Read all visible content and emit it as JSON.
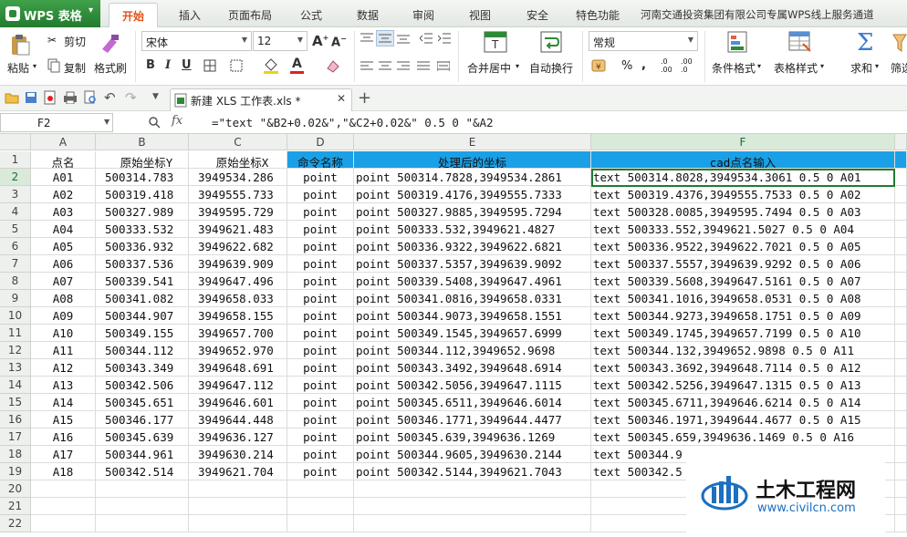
{
  "app": {
    "name": "WPS 表格"
  },
  "menu_tabs": [
    "开始",
    "插入",
    "页面布局",
    "公式",
    "数据",
    "审阅",
    "视图",
    "安全",
    "特色功能",
    "河南交通投资集团有限公司专属WPS线上服务通道"
  ],
  "ribbon": {
    "paste": "粘贴",
    "cut": "剪切",
    "copy": "复制",
    "format_painter": "格式刷",
    "font_name": "宋体",
    "font_size": "12",
    "merge_center": "合并居中",
    "wrap_text": "自动换行",
    "number_format": "常规",
    "percent": "%",
    "thousands": ",",
    "conditional_format": "条件格式",
    "table_style": "表格样式",
    "sum": "求和",
    "filter": "筛选"
  },
  "doc_tab": {
    "title": "新建 XLS 工作表.xls *"
  },
  "formula_bar": {
    "cell_ref": "F2",
    "fx": "fx",
    "formula": "=\"text \"&B2+0.02&\",\"&C2+0.02&\" 0.5 0 \"&A2"
  },
  "columns": [
    "A",
    "B",
    "C",
    "D",
    "E",
    "F"
  ],
  "headers": [
    "点名",
    "原始坐标Y",
    "原始坐标X",
    "命令名称",
    "处理后的坐标",
    "cad点名输入"
  ],
  "rows": [
    [
      "A01",
      "500314.783",
      "3949534.286",
      "point",
      "point 500314.7828,3949534.2861",
      "text 500314.8028,3949534.3061 0.5 0 A01"
    ],
    [
      "A02",
      "500319.418",
      "3949555.733",
      "point",
      "point 500319.4176,3949555.7333",
      "text 500319.4376,3949555.7533 0.5 0 A02"
    ],
    [
      "A03",
      "500327.989",
      "3949595.729",
      "point",
      "point 500327.9885,3949595.7294",
      "text 500328.0085,3949595.7494 0.5 0 A03"
    ],
    [
      "A04",
      "500333.532",
      "3949621.483",
      "point",
      "point 500333.532,3949621.4827",
      "text 500333.552,3949621.5027 0.5 0 A04"
    ],
    [
      "A05",
      "500336.932",
      "3949622.682",
      "point",
      "point 500336.9322,3949622.6821",
      "text 500336.9522,3949622.7021 0.5 0 A05"
    ],
    [
      "A06",
      "500337.536",
      "3949639.909",
      "point",
      "point 500337.5357,3949639.9092",
      "text 500337.5557,3949639.9292 0.5 0 A06"
    ],
    [
      "A07",
      "500339.541",
      "3949647.496",
      "point",
      "point 500339.5408,3949647.4961",
      "text 500339.5608,3949647.5161 0.5 0 A07"
    ],
    [
      "A08",
      "500341.082",
      "3949658.033",
      "point",
      "point 500341.0816,3949658.0331",
      "text 500341.1016,3949658.0531 0.5 0 A08"
    ],
    [
      "A09",
      "500344.907",
      "3949658.155",
      "point",
      "point 500344.9073,3949658.1551",
      "text 500344.9273,3949658.1751 0.5 0 A09"
    ],
    [
      "A10",
      "500349.155",
      "3949657.700",
      "point",
      "point 500349.1545,3949657.6999",
      "text 500349.1745,3949657.7199 0.5 0 A10"
    ],
    [
      "A11",
      "500344.112",
      "3949652.970",
      "point",
      "point 500344.112,3949652.9698",
      "text 500344.132,3949652.9898 0.5 0 A11"
    ],
    [
      "A12",
      "500343.349",
      "3949648.691",
      "point",
      "point 500343.3492,3949648.6914",
      "text 500343.3692,3949648.7114 0.5 0 A12"
    ],
    [
      "A13",
      "500342.506",
      "3949647.112",
      "point",
      "point 500342.5056,3949647.1115",
      "text 500342.5256,3949647.1315 0.5 0 A13"
    ],
    [
      "A14",
      "500345.651",
      "3949646.601",
      "point",
      "point 500345.6511,3949646.6014",
      "text 500345.6711,3949646.6214 0.5 0 A14"
    ],
    [
      "A15",
      "500346.177",
      "3949644.448",
      "point",
      "point 500346.1771,3949644.4477",
      "text 500346.1971,3949644.4677 0.5 0 A15"
    ],
    [
      "A16",
      "500345.639",
      "3949636.127",
      "point",
      "point 500345.639,3949636.1269",
      "text 500345.659,3949636.1469 0.5 0 A16"
    ],
    [
      "A17",
      "500344.961",
      "3949630.214",
      "point",
      "point 500344.9605,3949630.2144",
      "text 500344.9"
    ],
    [
      "A18",
      "500342.514",
      "3949621.704",
      "point",
      "point 500342.5144,3949621.7043",
      "text 500342.5"
    ]
  ],
  "row_numbers": [
    "1",
    "2",
    "3",
    "4",
    "5",
    "6",
    "7",
    "8",
    "9",
    "10",
    "11",
    "12",
    "13",
    "14",
    "15",
    "16",
    "17",
    "18",
    "19",
    "20",
    "21",
    "22"
  ],
  "watermark": {
    "title": "土木工程网",
    "url": "www.civilcn.com"
  },
  "colors": {
    "accent_green": "#2d8a37",
    "header_blue": "#1aa0e6",
    "tab_orange": "#e0541b"
  }
}
